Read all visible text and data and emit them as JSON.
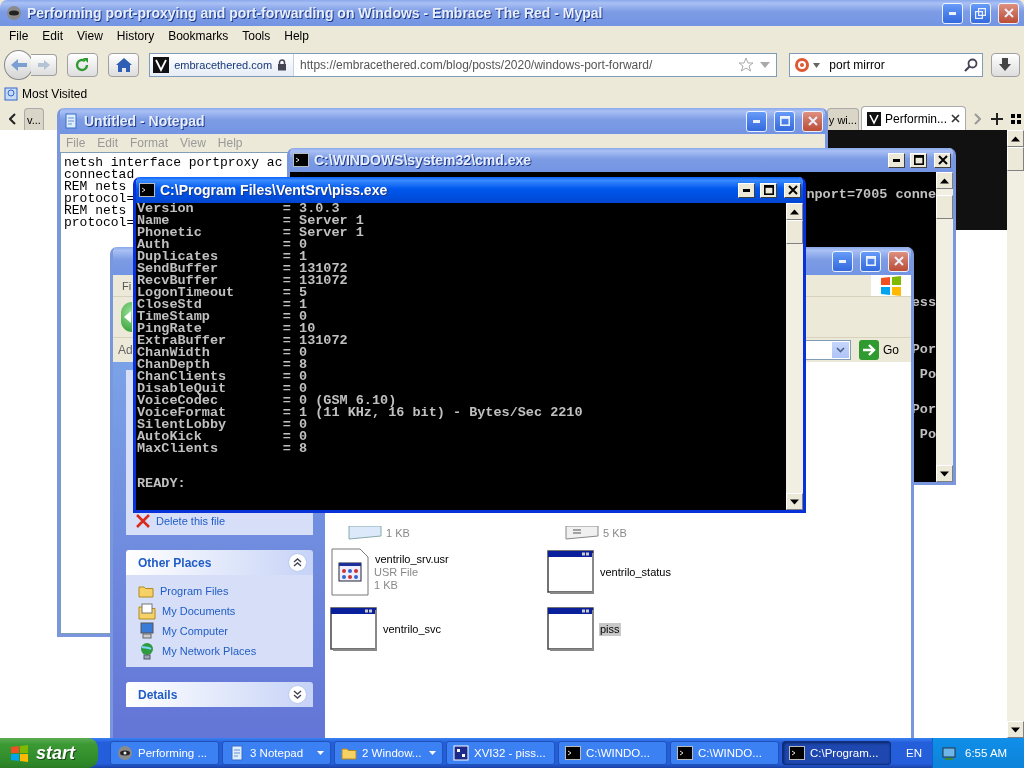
{
  "browser": {
    "title": "Performing port-proxying and port-forwarding on Windows - Embrace The Red - Mypal",
    "active": false,
    "menu": [
      "File",
      "Edit",
      "View",
      "History",
      "Bookmarks",
      "Tools",
      "Help"
    ],
    "site_identity": "embracethered.com",
    "url": "https://embracethered.com/blog/posts/2020/windows-port-forward/",
    "search": {
      "value": "port mirror"
    },
    "bookmarks": [
      "Most Visited"
    ],
    "tabs": [
      {
        "label": "v...",
        "selected": false
      },
      {
        "label": "y wi...",
        "selected": false
      },
      {
        "label": "Performin...",
        "selected": true
      }
    ]
  },
  "notepad": {
    "title": "Untitled - Notepad",
    "active": false,
    "menu": [
      "File",
      "Edit",
      "Format",
      "View",
      "Help"
    ],
    "lines": [
      "netsh interface portproxy ac",
      "connectad",
      "REM nets",
      "protocol=",
      "REM nets",
      "protocol="
    ]
  },
  "cmd": {
    "title": "C:\\WINDOWS\\system32\\cmd.exe",
    "active": false,
    "lines": [
      "nport=7005 conne",
      "ess",
      "Por",
      "Po",
      "Por",
      "Po"
    ]
  },
  "explorer": {
    "active": false,
    "menu": [
      "Fi"
    ],
    "address_label": "Ad",
    "go_button": "Go",
    "tasks": [
      {
        "label": "Delete this file",
        "kind": "delete"
      }
    ],
    "panels": [
      {
        "title": "Other Places",
        "expanded": true,
        "items": [
          {
            "label": "Program Files",
            "kind": "folder"
          },
          {
            "label": "My Documents",
            "kind": "documents"
          },
          {
            "label": "My Computer",
            "kind": "computer"
          },
          {
            "label": "My Network Places",
            "kind": "network"
          }
        ]
      },
      {
        "title": "Details",
        "expanded": false
      }
    ],
    "files": [
      {
        "kind": "text",
        "size": "1 KB",
        "selected": false
      },
      {
        "kind": "list",
        "size": "5 KB",
        "selected": false
      },
      {
        "kind": "document",
        "name": "ventrilo_srv.usr",
        "type": "USR File",
        "size": "1 KB",
        "selected": false
      },
      {
        "kind": "program",
        "name": "ventrilo_status",
        "selected": false
      },
      {
        "kind": "program",
        "name": "ventrilo_svc",
        "selected": false
      },
      {
        "kind": "program",
        "name": "piss",
        "selected": true
      }
    ]
  },
  "console": {
    "title": "C:\\Program Files\\VentSrv\\piss.exe",
    "active": true,
    "lines": [
      "Version           = 3.0.3",
      "Name              = Server 1",
      "Phonetic          = Server 1",
      "Auth              = 0",
      "Duplicates        = 1",
      "SendBuffer        = 131072",
      "RecvBuffer        = 131072",
      "LogonTimeout      = 5",
      "CloseStd          = 1",
      "TimeStamp         = 0",
      "PingRate          = 10",
      "ExtraBuffer       = 131072",
      "ChanWidth         = 0",
      "ChanDepth         = 8",
      "ChanClients       = 0",
      "DisableQuit       = 0",
      "VoiceCodec        = 0 (GSM 6.10)",
      "VoiceFormat       = 1 (11 KHz, 16 bit) - Bytes/Sec 2210",
      "SilentLobby       = 0",
      "AutoKick          = 0",
      "MaxClients        = 8"
    ],
    "prompt": "READY:"
  },
  "taskbar": {
    "start": "start",
    "items": [
      {
        "label": "Performing ...",
        "kind": "browser",
        "group": false,
        "selected": false
      },
      {
        "label": "3 Notepad",
        "kind": "notepad",
        "group": true,
        "selected": false
      },
      {
        "label": "2 Window...",
        "kind": "folder",
        "group": true,
        "selected": false
      },
      {
        "label": "XVI32 - piss...",
        "kind": "hex",
        "group": false,
        "selected": false
      },
      {
        "label": "C:\\WINDO...",
        "kind": "console",
        "group": false,
        "selected": false
      },
      {
        "label": "C:\\WINDO...",
        "kind": "console",
        "group": false,
        "selected": false
      },
      {
        "label": "C:\\Program...",
        "kind": "console",
        "group": false,
        "selected": true
      }
    ],
    "language": "EN",
    "clock": "6:55 AM"
  }
}
